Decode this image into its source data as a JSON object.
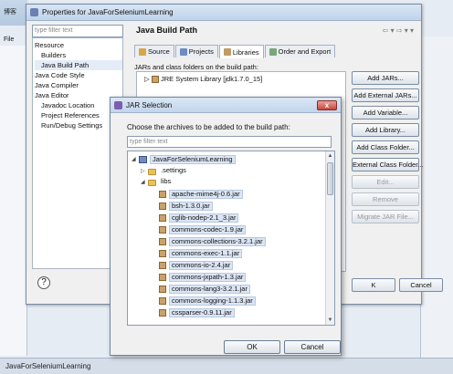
{
  "eclipse": {
    "title_fragment": "博客",
    "menu_file": "File",
    "status_text": "JavaForSeleniumLearning"
  },
  "properties": {
    "title": "Properties for JavaForSeleniumLearning",
    "filter_placeholder": "type filter text",
    "tree": [
      "Resource",
      "Builders",
      "Java Build Path",
      "Java Code Style",
      "Java Compiler",
      "Java Editor",
      "Javadoc Location",
      "Project References",
      "Run/Debug Settings"
    ],
    "section_title": "Java Build Path",
    "tabs": [
      "Source",
      "Projects",
      "Libraries",
      "Order and Export"
    ],
    "jars_caption": "JARs and class folders on the build path:",
    "jre_entry": "JRE System Library [jdk1.7.0_15]",
    "buttons": [
      "Add JARs...",
      "Add External JARs...",
      "Add Variable...",
      "Add Library...",
      "Add Class Folder...",
      "External Class Folder...",
      "Edit...",
      "Remove",
      "Migrate JAR File..."
    ],
    "ok_label": "K",
    "cancel_label": "Cancel",
    "help_label": "?"
  },
  "jar_selection": {
    "title": "JAR Selection",
    "prompt": "Choose the archives to be added to the build path:",
    "filter_placeholder": "type filter text",
    "project": "JavaForSeleniumLearning",
    "folders": [
      ".settings",
      "libs"
    ],
    "jars": [
      "apache-mime4j-0.6.jar",
      "bsh-1.3.0.jar",
      "cglib-nodep-2.1_3.jar",
      "commons-codec-1.9.jar",
      "commons-collections-3.2.1.jar",
      "commons-exec-1.1.jar",
      "commons-io-2.4.jar",
      "commons-jxpath-1.3.jar",
      "commons-lang3-3.2.1.jar",
      "commons-logging-1.1.3.jar",
      "cssparser-0.9.11.jar"
    ],
    "ok_label": "OK",
    "cancel_label": "Cancel",
    "close_label": "x"
  }
}
